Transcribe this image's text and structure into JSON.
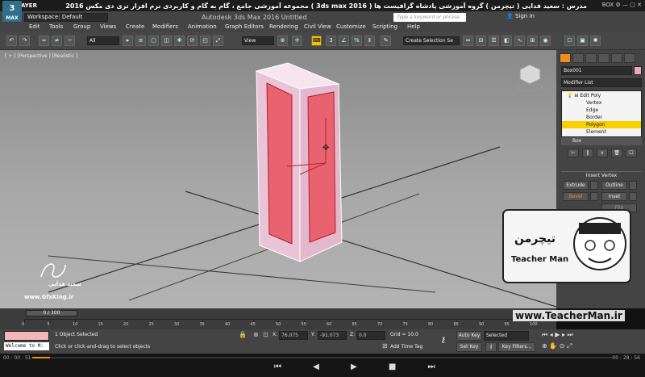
{
  "player": {
    "logo": "KMPLAYER",
    "video_title": "مجموعه آموزشی جامع ، گام به گام و کاربردی نرم افزار تری دی مکس 2016 ( 3ds max 2016 ) مدرس : سعید فدایی ( تیچرمن ) گروه آموزشی پادشاه گرافیست ها",
    "window_controls": "BOX ⚙ — ▢ ✕",
    "time_elapsed": "00 : 00 : 51",
    "time_total": "00 : 28 : 56",
    "progress": 0.03,
    "playback_controls": "⏮ ◀ ▶ ■ ⏭"
  },
  "app": {
    "logo": "3",
    "logo_caption": "MAX",
    "workspace": "Workspace: Default",
    "title": "Autodesk 3ds Max 2016    Untitled",
    "search_placeholder": "Type a keyword or phrase",
    "sign_in": "Sign In"
  },
  "menu": [
    "Edit",
    "Tools",
    "Group",
    "Views",
    "Create",
    "Modifiers",
    "Animation",
    "Graph Editors",
    "Rendering",
    "Civil View",
    "Customize",
    "Scripting",
    "Help"
  ],
  "toolbar": {
    "filter": "All",
    "ref_coord": "View",
    "selection_set": "Create Selection Se"
  },
  "viewport": {
    "label": "[ + ] [Perspective ] [Realistic ]"
  },
  "command_panel": {
    "object_name": "Box001",
    "object_color": "#f0a8c0",
    "modifier_list": "Modifier List",
    "stack": [
      {
        "label": "Edit Poly",
        "selected": false
      },
      {
        "label": "Vertex",
        "selected": false
      },
      {
        "label": "Edge",
        "selected": false
      },
      {
        "label": "Border",
        "selected": false
      },
      {
        "label": "Polygon",
        "selected": true
      },
      {
        "label": "Element",
        "selected": false
      }
    ],
    "stack_base": "Box",
    "rollout_title": "Insert Vertex",
    "buttons": {
      "extrude": "Extrude",
      "outline": "Outline",
      "bevel": "Bevel",
      "inset": "Inset",
      "flip": "Flip"
    }
  },
  "timeline": {
    "slider": "0 / 100",
    "ticks": [
      "0",
      "5",
      "10",
      "15",
      "20",
      "25",
      "30",
      "35",
      "40",
      "45",
      "50",
      "55",
      "60",
      "65",
      "70",
      "75",
      "80",
      "85",
      "90",
      "95",
      "100"
    ]
  },
  "status": {
    "welcome": "Welcome to M:",
    "selection": "1 Object Selected",
    "prompt": "Click or click-and-drag to select objects",
    "x": "76.075",
    "y": "-91.073",
    "z": "0.0",
    "grid": "Grid = 10.0",
    "add_time_tag": "Add Time Tag",
    "auto_key": "Auto Key",
    "set_key": "Set Key",
    "key_mode": "Selected",
    "key_filters": "Key Filters..."
  },
  "watermark": {
    "author": "سعید فدایی",
    "site": "www.GfxKing.ir",
    "teacher_fa": "تیچرمن",
    "teacher_en": "Teacher Man",
    "teacher_site": "www.TeacherMan.ir"
  },
  "colors": {
    "accent": "#f18a1f",
    "selected_subobject": "#f7d000",
    "box_body": "#e9c4d6",
    "polygon_selected": "#e8626f"
  }
}
